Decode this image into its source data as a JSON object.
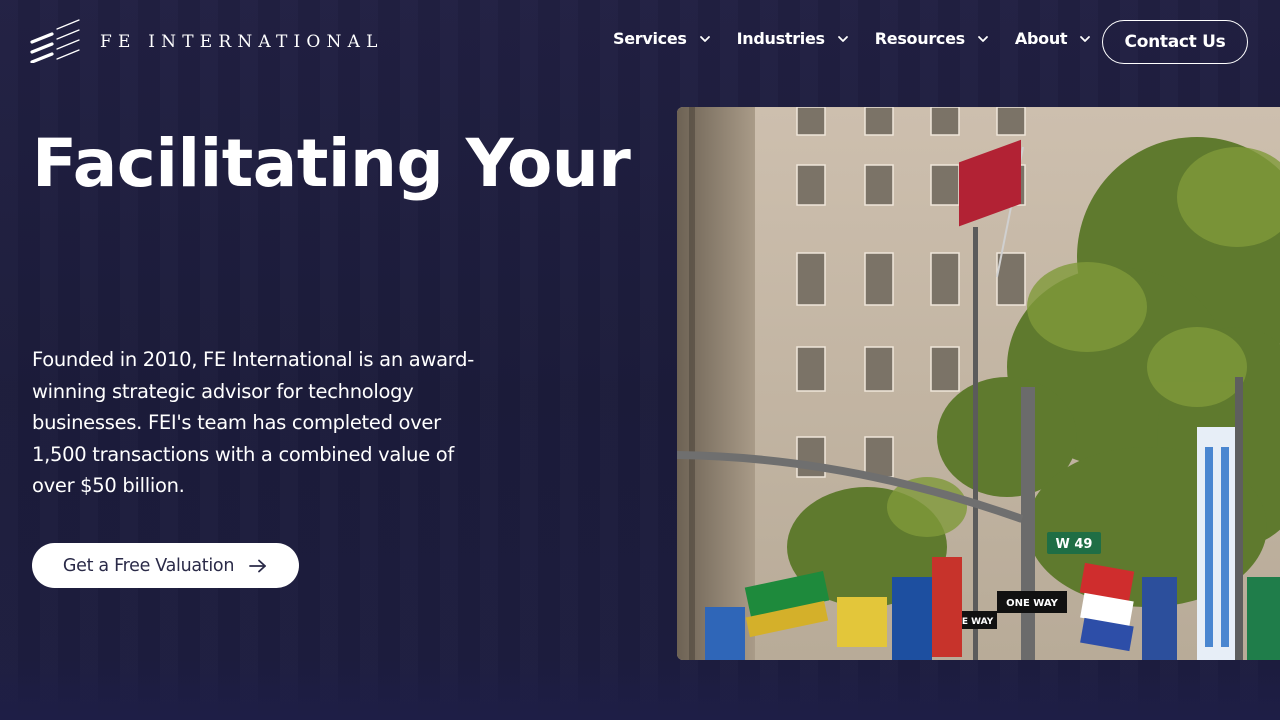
{
  "brand": {
    "logo_alt": "fe-international-logo",
    "name": "FE INTERNATIONAL"
  },
  "nav": {
    "items": [
      {
        "label": "Services",
        "icon": "chevron-down-icon"
      },
      {
        "label": "Industries",
        "icon": "chevron-down-icon"
      },
      {
        "label": "Resources",
        "icon": "chevron-down-icon"
      },
      {
        "label": "About",
        "icon": "chevron-down-icon"
      }
    ],
    "contact_label": "Contact Us"
  },
  "hero": {
    "title": "Facilitating Your",
    "description": "Founded in 2010, FE International is an award-winning strategic advisor for technology businesses. FEI's team has completed over 1,500 transactions with a combined value of over $50 billion.",
    "cta_label": "Get a Free Valuation",
    "cta_icon": "arrow-right-icon"
  },
  "photo": {
    "street_sign": "W 49",
    "one_way_sign_1": "ONE WAY",
    "one_way_sign_2": "ONE WAY"
  },
  "colors": {
    "background": "#1f1f3d",
    "text": "#ffffff",
    "button_bg": "#ffffff",
    "button_text": "#2a2a48"
  }
}
